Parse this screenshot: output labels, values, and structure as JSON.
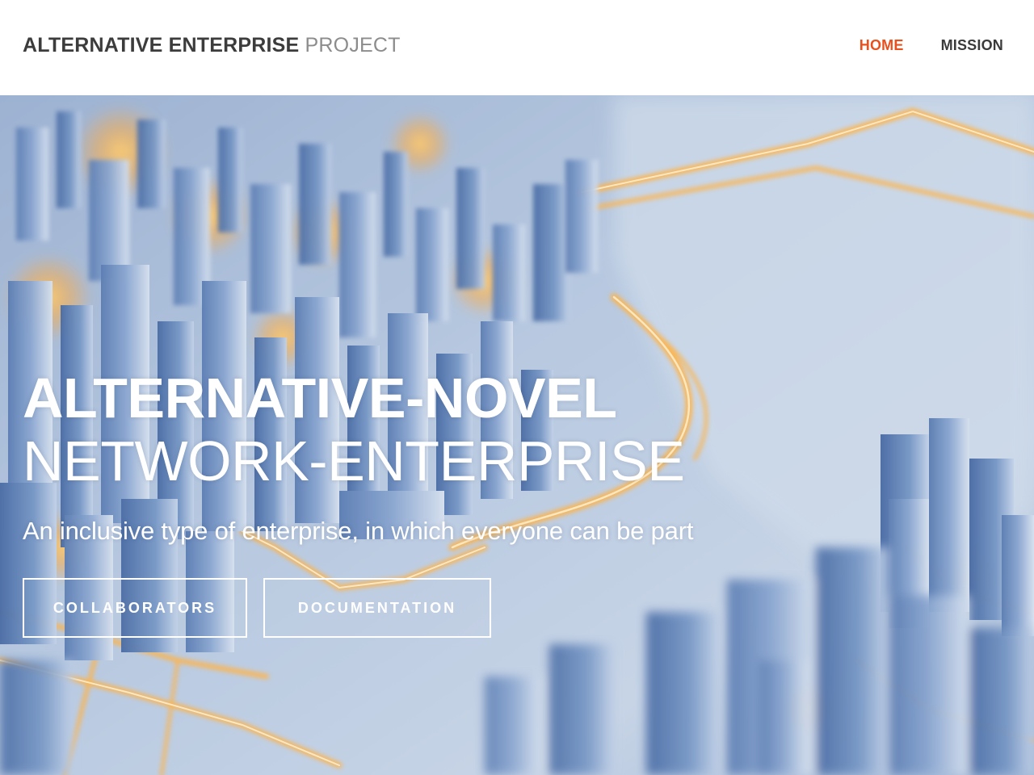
{
  "brand": {
    "strong": "ALTERNATIVE ENTERPRISE",
    "light": "PROJECT"
  },
  "nav": {
    "items": [
      {
        "label": "HOME",
        "active": true
      },
      {
        "label": "MISSION",
        "active": false
      }
    ]
  },
  "hero": {
    "title_bold": "ALTERNATIVE-NOVEL",
    "title_light": "NETWORK-ENTERPRISE",
    "subtitle": "An inclusive type of enterprise, in which everyone can be part",
    "buttons": {
      "collaborators": "COLLABORATORS",
      "documentation": "DOCUMENTATION"
    },
    "background_image": "isometric-city-circuit-illustration"
  },
  "colors": {
    "accent": "#e8501e",
    "nav_text": "#3a3a3a",
    "brand_light": "#8c8c8c",
    "hero_glow": "#ffb347",
    "hero_blue": "#7f9fcb"
  }
}
